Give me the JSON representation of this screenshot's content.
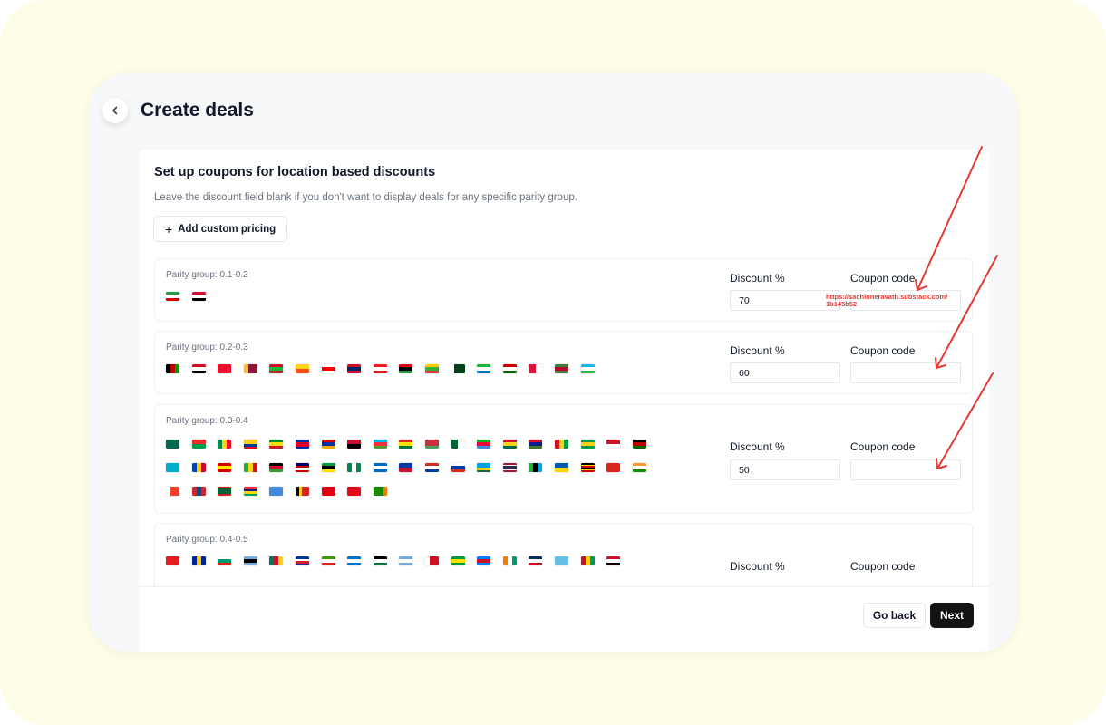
{
  "header": {
    "title": "Create deals",
    "back_icon": "chevron-left-icon"
  },
  "card": {
    "title": "Set up coupons for location based discounts",
    "subtitle": "Leave the discount field blank if you don't want to display deals for any specific parity group.",
    "add_button": {
      "icon": "plus-icon",
      "label": "Add custom pricing"
    }
  },
  "groups": [
    {
      "label": "Parity group: 0.1-0.2",
      "discount_label": "Discount %",
      "coupon_label": "Coupon code",
      "discount_value": "70",
      "coupon_value": "https://sachinneravath.substack.com/\n1b145b52",
      "flags": [
        {
          "code": "IR",
          "dir": "h",
          "colors": [
            "#239f40",
            "#ffffff",
            "#da0000"
          ]
        },
        {
          "code": "SD",
          "dir": "h",
          "colors": [
            "#d21034",
            "#ffffff",
            "#000000"
          ]
        }
      ]
    },
    {
      "label": "Parity group: 0.2-0.3",
      "discount_label": "Discount %",
      "coupon_label": "Coupon code",
      "discount_value": "60",
      "coupon_value": "",
      "flags": [
        {
          "code": "AF",
          "dir": "v",
          "colors": [
            "#000000",
            "#be0000",
            "#009900"
          ]
        },
        {
          "code": "EG",
          "dir": "h",
          "colors": [
            "#ce1126",
            "#ffffff",
            "#000000"
          ]
        },
        {
          "code": "KG",
          "dir": "h",
          "colors": [
            "#e8112d",
            "#e8112d"
          ]
        },
        {
          "code": "LK",
          "dir": "v",
          "colors": [
            "#ffbe29",
            "#8d153a",
            "#8d153a"
          ]
        },
        {
          "code": "BI",
          "dir": "h",
          "colors": [
            "#ce1126",
            "#1eb53a",
            "#ce1126"
          ]
        },
        {
          "code": "BT",
          "dir": "h",
          "colors": [
            "#ffd520",
            "#ff4e12"
          ]
        },
        {
          "code": "GE",
          "dir": "h",
          "colors": [
            "#ffffff",
            "#ff0000",
            "#ffffff"
          ]
        },
        {
          "code": "LA",
          "dir": "h",
          "colors": [
            "#ce1126",
            "#002868",
            "#ce1126"
          ]
        },
        {
          "code": "LB",
          "dir": "h",
          "colors": [
            "#ed1c24",
            "#ffffff",
            "#ed1c24"
          ]
        },
        {
          "code": "LY",
          "dir": "h",
          "colors": [
            "#e70013",
            "#000000",
            "#239e46"
          ]
        },
        {
          "code": "MM",
          "dir": "h",
          "colors": [
            "#fecb00",
            "#34b233",
            "#ea2839"
          ]
        },
        {
          "code": "PK",
          "dir": "v",
          "colors": [
            "#ffffff",
            "#01411c",
            "#01411c",
            "#01411c"
          ]
        },
        {
          "code": "SL",
          "dir": "h",
          "colors": [
            "#1eb53a",
            "#ffffff",
            "#0072c6"
          ]
        },
        {
          "code": "TJ",
          "dir": "h",
          "colors": [
            "#cc0000",
            "#ffffff",
            "#006600"
          ]
        },
        {
          "code": "NP",
          "dir": "v",
          "colors": [
            "#dc143c",
            "#ffffff"
          ]
        },
        {
          "code": "SR",
          "dir": "h",
          "colors": [
            "#377e3f",
            "#b40a2d",
            "#377e3f"
          ]
        },
        {
          "code": "UZ",
          "dir": "h",
          "colors": [
            "#1eb5e6",
            "#ffffff",
            "#1eb53a"
          ]
        }
      ]
    },
    {
      "label": "Parity group: 0.3-0.4",
      "discount_label": "Discount %",
      "coupon_label": "Coupon code",
      "discount_value": "50",
      "coupon_value": "",
      "flags": [
        {
          "code": "BD",
          "dir": "h",
          "colors": [
            "#006a4e",
            "#006a4e"
          ]
        },
        {
          "code": "BF",
          "dir": "h",
          "colors": [
            "#ef2b2d",
            "#009e49"
          ]
        },
        {
          "code": "BJ",
          "dir": "v",
          "colors": [
            "#008751",
            "#fcd116",
            "#e8112d"
          ]
        },
        {
          "code": "CO",
          "dir": "h",
          "colors": [
            "#fcd116",
            "#fcd116",
            "#003893",
            "#ce1126"
          ]
        },
        {
          "code": "ET",
          "dir": "h",
          "colors": [
            "#078930",
            "#fcdd09",
            "#da121a"
          ]
        },
        {
          "code": "KH",
          "dir": "h",
          "colors": [
            "#032ea1",
            "#e00025",
            "#e00025",
            "#032ea1"
          ]
        },
        {
          "code": "AM",
          "dir": "h",
          "colors": [
            "#d90012",
            "#0033a0",
            "#f2a800"
          ]
        },
        {
          "code": "AO",
          "dir": "h",
          "colors": [
            "#cc092f",
            "#000000"
          ]
        },
        {
          "code": "AZ",
          "dir": "h",
          "colors": [
            "#00b5e2",
            "#ef3340",
            "#509e2f"
          ]
        },
        {
          "code": "BO",
          "dir": "h",
          "colors": [
            "#d52b1e",
            "#f9e300",
            "#007934"
          ]
        },
        {
          "code": "BY",
          "dir": "h",
          "colors": [
            "#c8313e",
            "#c8313e",
            "#4aa657"
          ]
        },
        {
          "code": "DZ",
          "dir": "v",
          "colors": [
            "#006233",
            "#ffffff"
          ]
        },
        {
          "code": "ER",
          "dir": "h",
          "colors": [
            "#12ad2b",
            "#ea0437",
            "#4189dd"
          ]
        },
        {
          "code": "GH",
          "dir": "h",
          "colors": [
            "#ce1126",
            "#fcd116",
            "#006b3f"
          ]
        },
        {
          "code": "GM",
          "dir": "h",
          "colors": [
            "#ce1126",
            "#0c1c8c",
            "#3a7728"
          ]
        },
        {
          "code": "GW",
          "dir": "v",
          "colors": [
            "#ce1126",
            "#fcd116",
            "#009e49"
          ]
        },
        {
          "code": "GY",
          "dir": "h",
          "colors": [
            "#009e49",
            "#fcd116",
            "#009e49"
          ]
        },
        {
          "code": "ID",
          "dir": "h",
          "colors": [
            "#ce1126",
            "#ffffff"
          ]
        },
        {
          "code": "KE",
          "dir": "h",
          "colors": [
            "#000000",
            "#bb0000",
            "#006600"
          ]
        },
        {
          "code": "KZ",
          "dir": "h",
          "colors": [
            "#00afca",
            "#00afca"
          ]
        },
        {
          "code": "MD",
          "dir": "v",
          "colors": [
            "#0046ae",
            "#ffd200",
            "#cc092f"
          ]
        },
        {
          "code": "MK",
          "dir": "h",
          "colors": [
            "#d20000",
            "#ffe600",
            "#d20000"
          ]
        },
        {
          "code": "ML",
          "dir": "v",
          "colors": [
            "#14b53a",
            "#fcd116",
            "#ce1126"
          ]
        },
        {
          "code": "MW",
          "dir": "h",
          "colors": [
            "#000000",
            "#ce1126",
            "#339e35"
          ]
        },
        {
          "code": "MY",
          "dir": "h",
          "colors": [
            "#010066",
            "#cc0001",
            "#ffffff",
            "#cc0001"
          ]
        },
        {
          "code": "MZ",
          "dir": "h",
          "colors": [
            "#009a44",
            "#000000",
            "#fce100"
          ]
        },
        {
          "code": "NG",
          "dir": "v",
          "colors": [
            "#008751",
            "#ffffff",
            "#008751"
          ]
        },
        {
          "code": "NI",
          "dir": "h",
          "colors": [
            "#0067c6",
            "#ffffff",
            "#0067c6"
          ]
        },
        {
          "code": "PH",
          "dir": "h",
          "colors": [
            "#0038a8",
            "#ce1126"
          ]
        },
        {
          "code": "PY",
          "dir": "h",
          "colors": [
            "#d52b1e",
            "#ffffff",
            "#0038a8"
          ]
        },
        {
          "code": "RU",
          "dir": "h",
          "colors": [
            "#ffffff",
            "#0039a6",
            "#d52b1e"
          ]
        },
        {
          "code": "RW",
          "dir": "h",
          "colors": [
            "#00a1de",
            "#00a1de",
            "#fad201",
            "#20603d"
          ]
        },
        {
          "code": "TH",
          "dir": "h",
          "colors": [
            "#a51931",
            "#f4f5f8",
            "#2d2a4a",
            "#2d2a4a",
            "#f4f5f8",
            "#a51931"
          ]
        },
        {
          "code": "TZ",
          "dir": "v",
          "colors": [
            "#1eb53a",
            "#000000",
            "#00a3dd"
          ]
        },
        {
          "code": "UA",
          "dir": "h",
          "colors": [
            "#0057b7",
            "#ffd700"
          ]
        },
        {
          "code": "UG",
          "dir": "h",
          "colors": [
            "#000000",
            "#fcdc04",
            "#d90000",
            "#000000",
            "#fcdc04",
            "#d90000"
          ]
        },
        {
          "code": "VN",
          "dir": "h",
          "colors": [
            "#da251d",
            "#da251d"
          ]
        },
        {
          "code": "IN",
          "dir": "h",
          "colors": [
            "#ff9933",
            "#ffffff",
            "#138808"
          ]
        },
        {
          "code": "MG",
          "dir": "v",
          "colors": [
            "#ffffff",
            "#fc3d32",
            "#fc3d32"
          ]
        },
        {
          "code": "MN",
          "dir": "v",
          "colors": [
            "#c4272f",
            "#015197",
            "#c4272f"
          ]
        },
        {
          "code": "MR",
          "dir": "h",
          "colors": [
            "#d01c1f",
            "#006233",
            "#006233",
            "#006233",
            "#d01c1f"
          ]
        },
        {
          "code": "MU",
          "dir": "h",
          "colors": [
            "#ea2839",
            "#1a206d",
            "#ffd500",
            "#00a551"
          ]
        },
        {
          "code": "SO",
          "dir": "h",
          "colors": [
            "#4189dd",
            "#4189dd"
          ]
        },
        {
          "code": "TL",
          "dir": "v",
          "colors": [
            "#000000",
            "#ffc726",
            "#dc241f",
            "#dc241f"
          ]
        },
        {
          "code": "TN",
          "dir": "h",
          "colors": [
            "#e70013",
            "#e70013"
          ]
        },
        {
          "code": "TR",
          "dir": "h",
          "colors": [
            "#e30a17",
            "#e30a17"
          ]
        },
        {
          "code": "ZM",
          "dir": "v",
          "colors": [
            "#198a00",
            "#198a00",
            "#198a00",
            "#ef7d00"
          ]
        }
      ]
    },
    {
      "label": "Parity group: 0.4-0.5",
      "discount_label": "Discount %",
      "coupon_label": "Coupon code",
      "discount_value": "",
      "coupon_value": "",
      "flags": [
        {
          "code": "AL",
          "dir": "h",
          "colors": [
            "#e41e20",
            "#e41e20"
          ]
        },
        {
          "code": "BA",
          "dir": "v",
          "colors": [
            "#002395",
            "#fecb00",
            "#002395"
          ]
        },
        {
          "code": "BG",
          "dir": "h",
          "colors": [
            "#ffffff",
            "#00966e",
            "#d62612"
          ]
        },
        {
          "code": "BW",
          "dir": "h",
          "colors": [
            "#75aadb",
            "#000000",
            "#75aadb"
          ]
        },
        {
          "code": "CM",
          "dir": "v",
          "colors": [
            "#007a5e",
            "#ce1126",
            "#fcd116"
          ]
        },
        {
          "code": "CV",
          "dir": "h",
          "colors": [
            "#003893",
            "#ffffff",
            "#cf2027",
            "#003893"
          ]
        },
        {
          "code": "GQ",
          "dir": "h",
          "colors": [
            "#3e9a00",
            "#ffffff",
            "#e32118"
          ]
        },
        {
          "code": "HN",
          "dir": "h",
          "colors": [
            "#0073cf",
            "#ffffff",
            "#0073cf"
          ]
        },
        {
          "code": "JO",
          "dir": "h",
          "colors": [
            "#000000",
            "#ffffff",
            "#007a3d"
          ]
        },
        {
          "code": "AR",
          "dir": "h",
          "colors": [
            "#74acdf",
            "#ffffff",
            "#74acdf"
          ]
        },
        {
          "code": "BH",
          "dir": "v",
          "colors": [
            "#ffffff",
            "#ce1126",
            "#ce1126"
          ]
        },
        {
          "code": "BR",
          "dir": "h",
          "colors": [
            "#009c3b",
            "#ffdf00",
            "#009c3b"
          ]
        },
        {
          "code": "CD",
          "dir": "h",
          "colors": [
            "#007fff",
            "#ce1021",
            "#007fff"
          ]
        },
        {
          "code": "CI",
          "dir": "v",
          "colors": [
            "#f77f00",
            "#ffffff",
            "#009e60"
          ]
        },
        {
          "code": "DO",
          "dir": "h",
          "colors": [
            "#002d62",
            "#ffffff",
            "#ce1126"
          ]
        },
        {
          "code": "FJ",
          "dir": "h",
          "colors": [
            "#68bfe5",
            "#68bfe5"
          ]
        },
        {
          "code": "GN",
          "dir": "v",
          "colors": [
            "#ce1126",
            "#fcd116",
            "#009460"
          ]
        },
        {
          "code": "IQ",
          "dir": "h",
          "colors": [
            "#ce1126",
            "#ffffff",
            "#000000"
          ]
        }
      ]
    }
  ],
  "footer": {
    "back_label": "Go back",
    "next_label": "Next"
  },
  "annotation": {
    "arrow_color": "#e53935"
  }
}
